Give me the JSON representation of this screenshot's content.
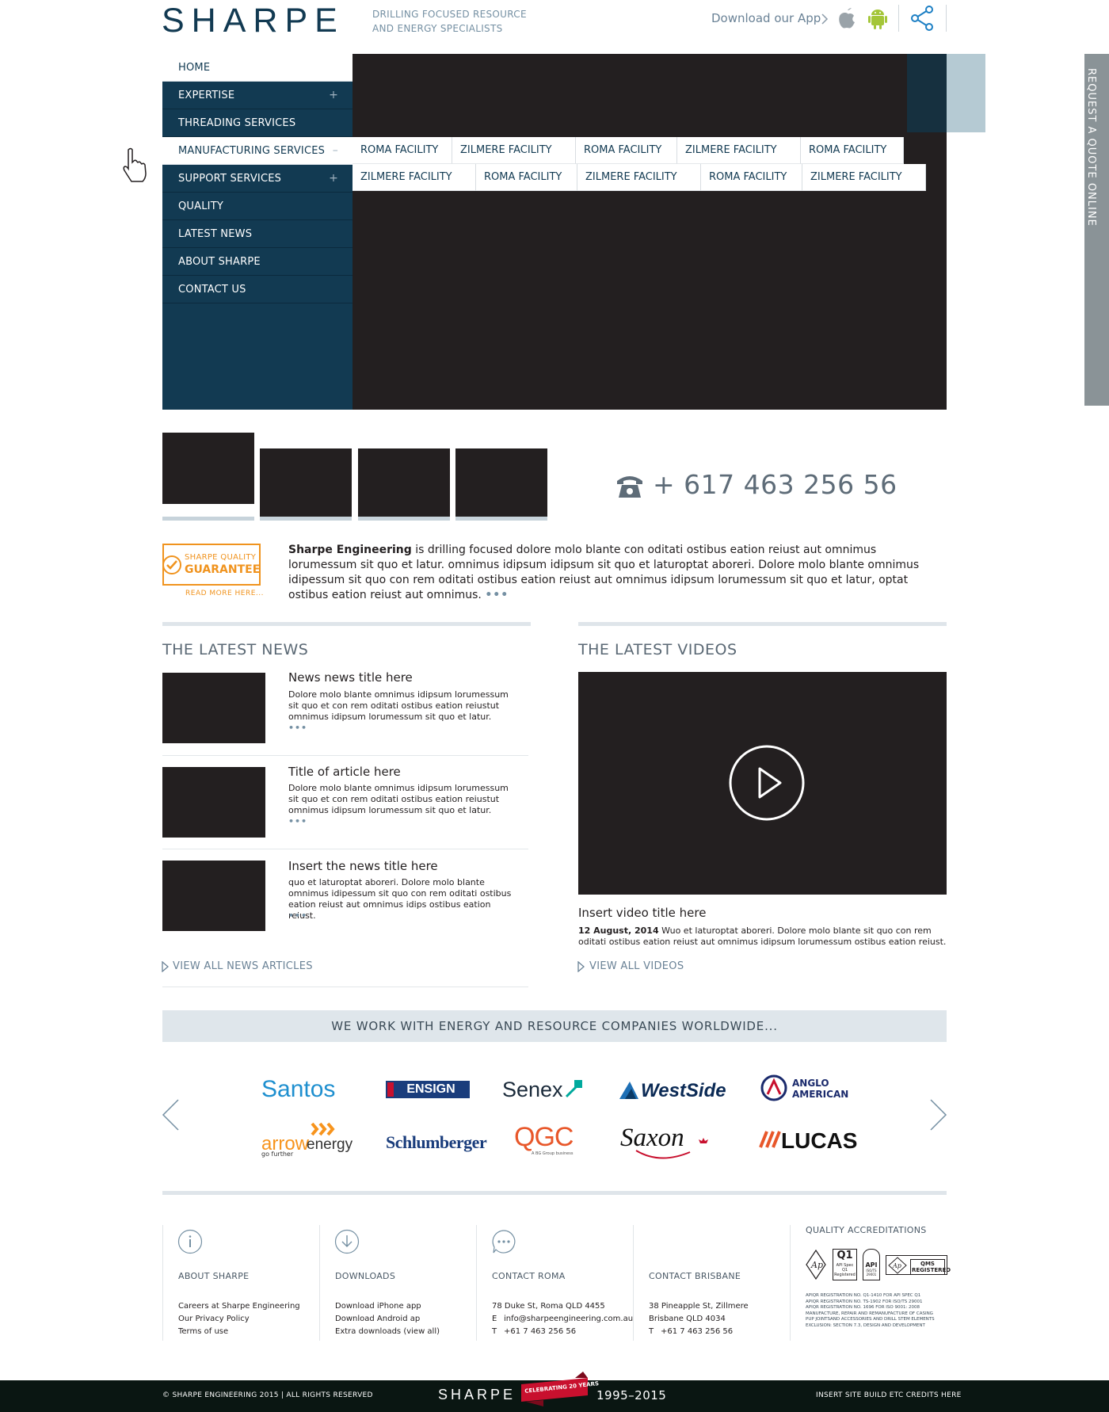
{
  "header": {
    "logo": "SHARPE",
    "tagline": "DRILLING FOCUSED RESOURCE\nAND ENERGY SPECIALISTS",
    "app_download": "Download our App"
  },
  "side_tab": "REQUEST A QUOTE ONLINE",
  "nav": {
    "items": [
      {
        "label": "HOME",
        "toggle": ""
      },
      {
        "label": "EXPERTISE",
        "toggle": "+"
      },
      {
        "label": "THREADING SERVICES",
        "toggle": ""
      },
      {
        "label": "MANUFACTURING SERVICES",
        "toggle": "–"
      },
      {
        "label": "SUPPORT SERVICES",
        "toggle": "+"
      },
      {
        "label": "QUALITY",
        "toggle": ""
      },
      {
        "label": "LATEST NEWS",
        "toggle": ""
      },
      {
        "label": "ABOUT SHARPE",
        "toggle": ""
      },
      {
        "label": "CONTACT US",
        "toggle": ""
      }
    ],
    "submenu_row1": [
      "ROMA FACILITY",
      "ZILMERE FACILITY",
      "ROMA FACILITY",
      "ZILMERE FACILITY",
      "ROMA FACILITY"
    ],
    "submenu_row2": [
      "ZILMERE FACILITY",
      "ROMA FACILITY",
      "ZILMERE FACILITY",
      "ROMA FACILITY",
      "ZILMERE FACILITY"
    ]
  },
  "phone": "+ 617 463 256 56",
  "guarantee": {
    "line1": "SHARPE QUALITY",
    "line2": "GUARANTEE",
    "read_more": "READ MORE HERE..."
  },
  "about": {
    "company": "Sharpe Engineering",
    "text": " is drilling focused dolore molo blante con oditati ostibus eation reiust aut omnimus lorumessum sit quo et latur. omnimus idipsum idipsum sit quo et laturoptat aboreri. Dolore molo blante omnimus idipessum sit quo con rem oditati ostibus eation reiust aut omnimus idipsum lorumessum sit quo et latur, optat ostibus eation reiust aut omnimus.",
    "more": "•••"
  },
  "news": {
    "heading": "THE LATEST NEWS",
    "articles": [
      {
        "title": "News news title here",
        "body": "Dolore molo blante omnimus idipsum lorumessum sit quo et con rem oditati ostibus eation reiustut omnimus idipsum lorumessum sit quo et latur."
      },
      {
        "title": "Title of article here",
        "body": "Dolore molo blante omnimus idipsum lorumessum sit quo et con rem oditati ostibus eation reiustut omnimus idipsum lorumessum sit quo et latur."
      },
      {
        "title": "Insert the news title here",
        "body": "quo et laturoptat aboreri. Dolore molo blante omnimus idipessum sit quo con rem oditati ostibus eation reiust aut omnimus idips ostibus eation reiust."
      }
    ],
    "more": "•••",
    "view_all": "VIEW ALL NEWS ARTICLES"
  },
  "videos": {
    "heading": "THE LATEST VIDEOS",
    "title": "Insert video title here",
    "date": "12 August, 2014",
    "body": " Wuo et laturoptat aboreri. Dolore molo blante sit quo con rem oditati ostibus eation reiust aut omnimus idipsum lorumessum ostibus eation reiust.",
    "view_all": "VIEW ALL VIDEOS"
  },
  "partners": {
    "heading": "WE WORK WITH ENERGY AND RESOURCE COMPANIES WORLDWIDE...",
    "row1": [
      "Santos",
      "ENSIGN",
      "Senex",
      "WestSide",
      "ANGLO",
      "AMERICAN"
    ],
    "row2": [
      "arrow",
      "energy",
      "go further",
      "Schlumberger",
      "QGC",
      "A BG Group business",
      "Saxon",
      "LUCAS"
    ]
  },
  "footer": {
    "about": {
      "title": "ABOUT SHARPE",
      "links": [
        "Careers at Sharpe Engineering",
        "Our Privacy Policy",
        "Terms of use"
      ]
    },
    "downloads": {
      "title": "DOWNLOADS",
      "links": [
        "Download iPhone app",
        "Download Android ap",
        "Extra downloads (view all)"
      ]
    },
    "roma": {
      "title": "CONTACT ROMA",
      "address": "78 Duke St, Roma QLD 4455",
      "email_label": "E",
      "email": "info@sharpeengineering.com.au",
      "phone_label": "T",
      "phone": "+61 7 463 256 56"
    },
    "brisbane": {
      "title": "CONTACT BRISBANE",
      "address1": "38 Pineapple St, Zillmere",
      "address2": "Brisbane QLD 4034",
      "phone_label": "T",
      "phone": "+61 7 463 256 56"
    },
    "quality": {
      "title": "QUALITY ACCREDITATIONS",
      "badges": [
        "Q1",
        "API Spec Q1 Registered",
        "API",
        "ISO/TS 29001",
        "QMS REGISTERED"
      ],
      "notes": [
        "APIQR REGISTRATION NO. Q1-1410 FOR API SPEC Q1",
        "APIQR REGISTRATION NO. TS-1902 FOR ISO/TS 29001",
        "APIQR REGISTRATION NO. 1696 FOR ISO 9001: 2008",
        "MANUFACTURE, REPAIR AND REMANUFACTURE OF CASING",
        "PUP JOINTSAND ACCESSORIES AND DRILL STEM ELEMENTS",
        "EXCLUSION: SECTION 7.3, DESIGN AND DEVELOPMENT"
      ]
    }
  },
  "bottom": {
    "copyright": "© SHARPE ENGINEERING 2015  |  ALL RIGHTS RESERVED",
    "logo": "SHARPE",
    "ribbon": "CELEBRATING 20 YEARS",
    "years": "1995–2015",
    "credits": "INSERT SITE BUILD ETC CREDITS HERE"
  },
  "colors": {
    "navy": "#123a52",
    "dark": "#231f20",
    "accent_orange": "#f0931e",
    "slate": "#6a8296"
  }
}
